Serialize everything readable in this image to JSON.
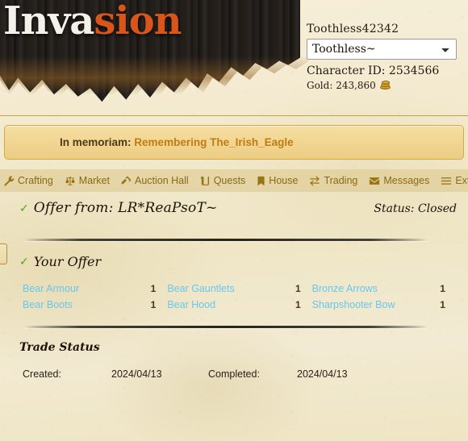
{
  "brand": {
    "logo_part_white": "Inva",
    "logo_part_orange": "sion",
    "logo_white_color": "#f4f1ea",
    "logo_orange_color": "#d8551c"
  },
  "account": {
    "username": "Toothless42342",
    "character_selected": "Toothless~",
    "character_options": [
      "Toothless~"
    ],
    "character_id_label": "Character ID: 2534566",
    "gold_label": "Gold: 243,860",
    "coin_icon": "gold-coins-icon"
  },
  "memoriam": {
    "label": "In memoriam:",
    "value": "Remembering The_Irish_Eagle",
    "label_color": "#4d3a14",
    "value_color": "#c07c13"
  },
  "nav": {
    "items": [
      {
        "label": "Crafting",
        "icon": "wrench-icon"
      },
      {
        "label": "Market",
        "icon": "scales-icon"
      },
      {
        "label": "Auction Hall",
        "icon": "gavel-icon"
      },
      {
        "label": "Quests",
        "icon": "scroll-icon"
      },
      {
        "label": "House",
        "icon": "bookmark-icon"
      },
      {
        "label": "Trading",
        "icon": "exchange-arrows-icon"
      },
      {
        "label": "Messages",
        "icon": "envelope-icon"
      }
    ],
    "extras": {
      "label": "Extras",
      "icon": "hamburger-menu-icon"
    },
    "link_color": "#8a6a14"
  },
  "offer": {
    "check_icon": "green-check-icon",
    "title": "Offer from: LR*ReaPsoT~",
    "status": "Status: Closed"
  },
  "your_offer": {
    "check_icon": "green-check-icon",
    "title": "Your Offer",
    "items": [
      {
        "name": "Bear Armour",
        "qty": "1"
      },
      {
        "name": "Bear Gauntlets",
        "qty": "1"
      },
      {
        "name": "Bronze Arrows",
        "qty": "1"
      },
      {
        "name": "Bear Boots",
        "qty": "1"
      },
      {
        "name": "Bear Hood",
        "qty": "1"
      },
      {
        "name": "Sharpshooter Bow",
        "qty": "1"
      }
    ],
    "item_link_color": "#67c7ee"
  },
  "trade_status": {
    "title": "Trade Status",
    "created_label": "Created:",
    "created_value": "2024/04/13",
    "completed_label": "Completed:",
    "completed_value": "2024/04/13"
  }
}
